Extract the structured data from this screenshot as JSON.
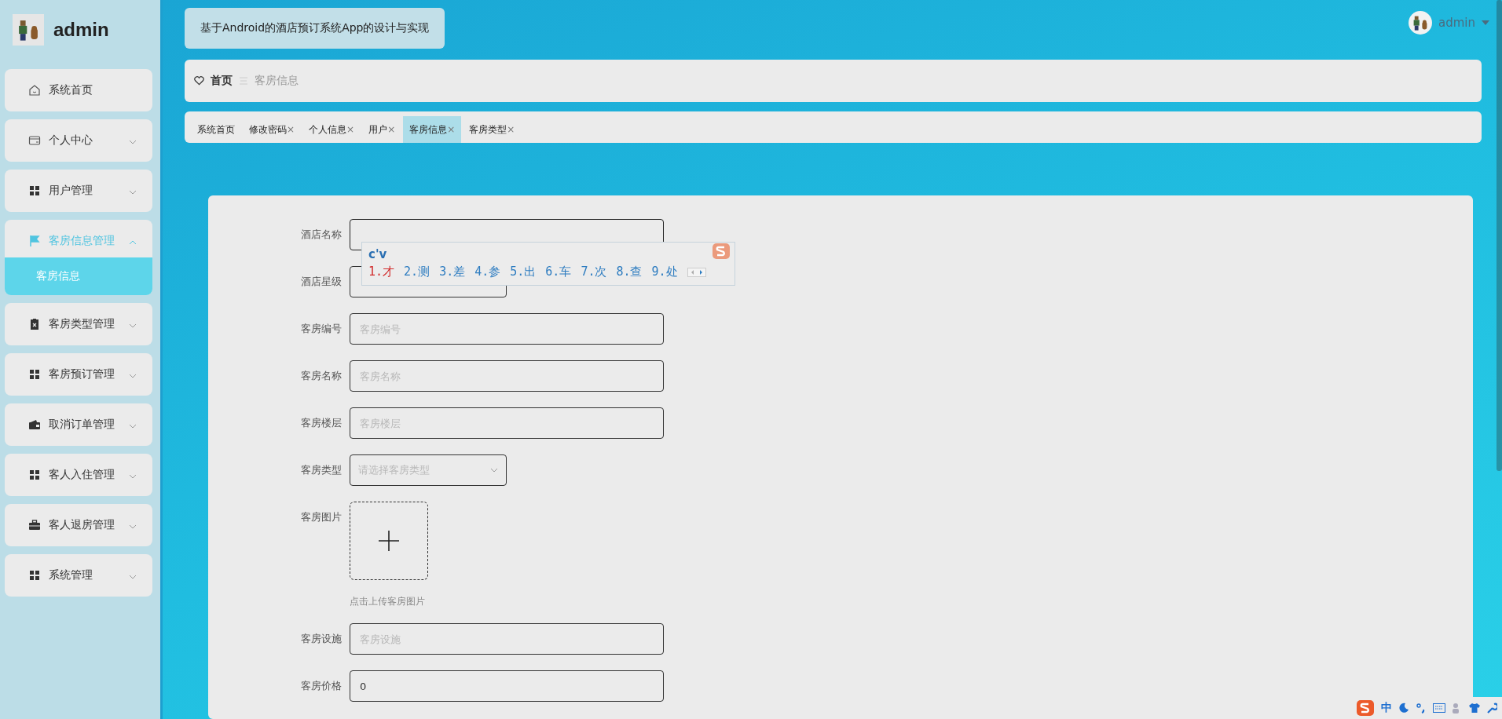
{
  "sidebar": {
    "user": "admin",
    "items": [
      {
        "label": "系统首页",
        "kind": "link",
        "selected": false
      },
      {
        "label": "个人中心",
        "kind": "submenu",
        "expanded": false,
        "selected": false
      },
      {
        "label": "用户管理",
        "kind": "submenu",
        "expanded": false,
        "selected": false
      },
      {
        "label": "客房信息管理",
        "kind": "submenu",
        "expanded": true,
        "selected": true,
        "children": [
          {
            "label": "客房信息",
            "selected": true
          }
        ]
      },
      {
        "label": "客房类型管理",
        "kind": "submenu",
        "expanded": false,
        "selected": false
      },
      {
        "label": "客房预订管理",
        "kind": "submenu",
        "expanded": false,
        "selected": false
      },
      {
        "label": "取消订单管理",
        "kind": "submenu",
        "expanded": false,
        "selected": false
      },
      {
        "label": "客人入住管理",
        "kind": "submenu",
        "expanded": false,
        "selected": false
      },
      {
        "label": "客人退房管理",
        "kind": "submenu",
        "expanded": false,
        "selected": false
      },
      {
        "label": "系统管理",
        "kind": "submenu",
        "expanded": false,
        "selected": false
      }
    ]
  },
  "header": {
    "title": "基于Android的酒店预订系统App的设计与实现",
    "user": "admin"
  },
  "breadcrumb": {
    "home": "首页",
    "current": "客房信息"
  },
  "tabs": [
    {
      "label": "系统首页",
      "selected": false
    },
    {
      "label": "修改密码",
      "close": "×",
      "selected": false
    },
    {
      "label": "个人信息",
      "close": "×",
      "selected": false
    },
    {
      "label": "用户",
      "close": "×",
      "selected": false
    },
    {
      "label": "客房信息",
      "close": "×",
      "selected": true
    },
    {
      "label": "客房类型",
      "close": "×",
      "selected": false
    }
  ],
  "form": {
    "fields": [
      {
        "label": "酒店名称",
        "kind": "input",
        "focused": true
      },
      {
        "label": "酒店星级",
        "kind": "select",
        "focused": false
      },
      {
        "label": "客房编号",
        "kind": "input",
        "placeholder": "客房编号",
        "focused": false
      },
      {
        "label": "客房名称",
        "kind": "input",
        "placeholder": "客房名称",
        "focused": false
      },
      {
        "label": "客房楼层",
        "kind": "input",
        "placeholder": "客房楼层",
        "focused": false
      },
      {
        "label": "客房类型",
        "kind": "select",
        "placeholder": "请选择客房类型",
        "focused": false
      },
      {
        "label": "客房图片",
        "kind": "upload",
        "hint": "点击上传客房图片"
      },
      {
        "label": "客房设施",
        "kind": "input",
        "placeholder": "客房设施",
        "focused": false
      },
      {
        "label": "客房价格",
        "kind": "input",
        "value": "0",
        "focused": false
      }
    ]
  },
  "ime": {
    "composition": "c'v",
    "candidates": [
      {
        "text": "1.才",
        "selected": true
      },
      {
        "text": "2.测",
        "selected": false
      },
      {
        "text": "3.差",
        "selected": false
      },
      {
        "text": "4.参",
        "selected": false
      },
      {
        "text": "5.出",
        "selected": false
      },
      {
        "text": "6.车",
        "selected": false
      },
      {
        "text": "7.次",
        "selected": false
      },
      {
        "text": "8.查",
        "selected": false
      },
      {
        "text": "9.处",
        "selected": false
      }
    ]
  },
  "tray": {
    "mode": "中"
  }
}
